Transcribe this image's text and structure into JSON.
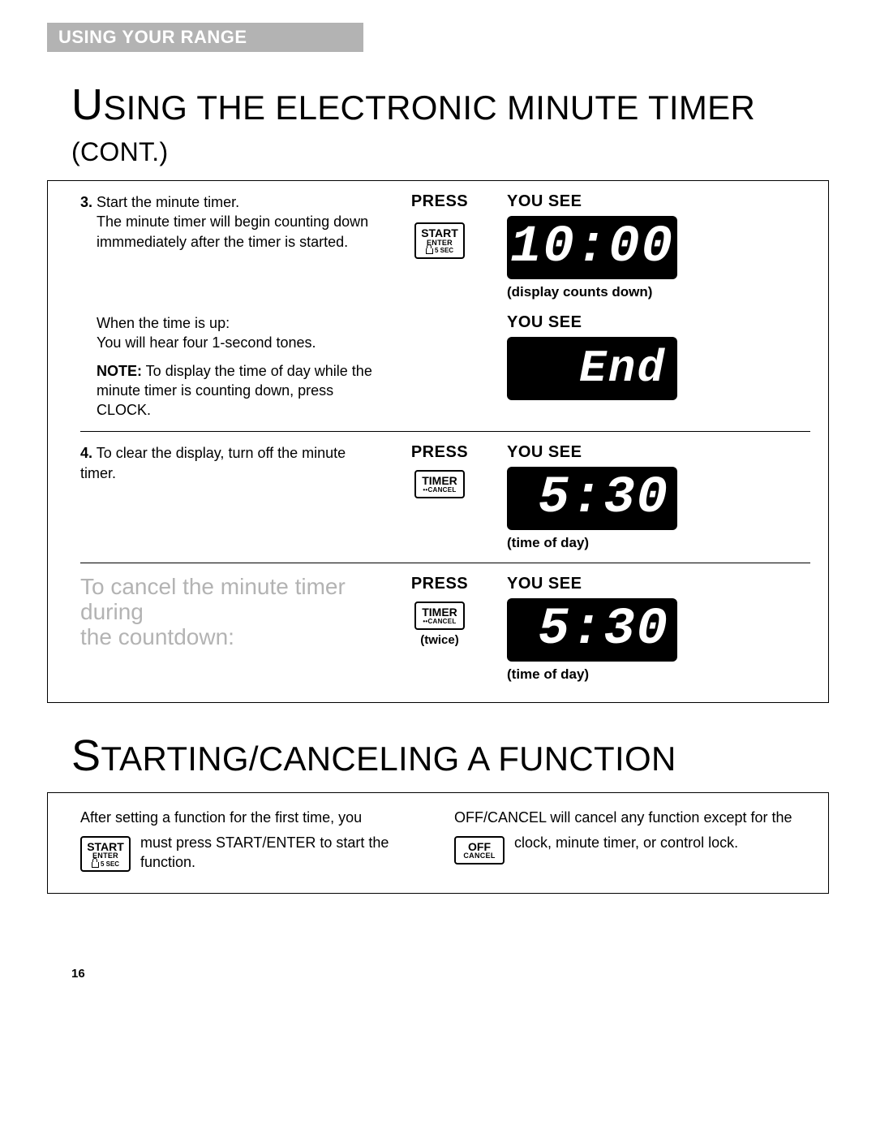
{
  "tab": "USING YOUR RANGE",
  "h1a_pre": "U",
  "h1a": "SING THE ELECTRONIC MINUTE TIMER",
  "h1a_suffix_pre": " (",
  "h1a_suffix": "CONT.",
  "h1a_suffix_post": ")",
  "press": "PRESS",
  "yousee": "YOU SEE",
  "step3_num": "3.",
  "step3_a": " Start the minute timer.",
  "step3_b": "The minute timer will begin counting down immmediately after the timer is started.",
  "lcd1": "10:00",
  "lcd1_cap": "(display counts down)",
  "step3_c": "When the time is up:",
  "step3_d": "You will hear four 1-second tones.",
  "note_label": "NOTE:",
  "step3_note": " To display the time of day while the minute timer is counting down, press CLOCK.",
  "lcd2": "End",
  "step4_num": "4.",
  "step4_a": " To clear the display, turn off the minute timer.",
  "lcd3": "5:30",
  "lcd3_cap": "(time of day)",
  "cancel_h1": "To cancel the minute timer during",
  "cancel_h2": "the countdown:",
  "twice": "(twice)",
  "lcd4": "5:30",
  "lcd4_cap": "(time of day)",
  "btn_start_l1": "START",
  "btn_start_l2": "ENTER",
  "btn_start_l3": "5 SEC",
  "btn_timer_l1": "TIMER",
  "btn_timer_l2": "CANCEL",
  "btn_off_l1": "OFF",
  "btn_off_l2": "CANCEL",
  "h2_pre": "S",
  "h2": "TARTING/CANCELING A FUNCTION",
  "p2a": "After setting a function for the first time, you must press START/ENTER to start the function.",
  "p2b": "OFF/CANCEL will cancel any function except for the clock, minute timer, or control lock.",
  "pagenum": "16"
}
